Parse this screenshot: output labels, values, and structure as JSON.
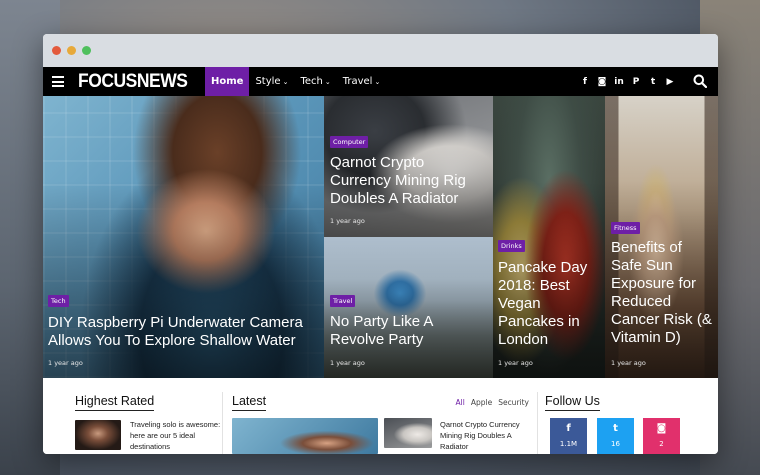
{
  "nav": {
    "logo": "FOCUSNEWS",
    "menu": [
      {
        "label": "Home",
        "active": true
      },
      {
        "label": "Style",
        "caret": "⌄"
      },
      {
        "label": "Tech",
        "caret": "⌄"
      },
      {
        "label": "Travel",
        "caret": "⌄"
      }
    ],
    "socials": [
      "f",
      "◙",
      "in",
      "P",
      "t",
      "▶"
    ],
    "accent_color": "#6e1fa6"
  },
  "hero": [
    {
      "category": "Tech",
      "title": "DIY Raspberry Pi Underwater Camera Allows You To Explore Shallow Water",
      "date": "1 year ago"
    },
    {
      "category": "Computer",
      "title": "Qarnot Crypto Currency Mining Rig Doubles A Radiator",
      "date": "1 year ago"
    },
    {
      "category": "Travel",
      "title": "No Party Like A Revolve Party",
      "date": "1 year ago"
    },
    {
      "category": "Drinks",
      "title": "Pancake Day 2018: Best Vegan Pancakes in London",
      "date": "1 year ago"
    },
    {
      "category": "Fitness",
      "title": "Benefits of Safe Sun Exposure for Reduced Cancer Risk (& Vitamin D)",
      "date": "1 year ago"
    }
  ],
  "highest_rated": {
    "title": "Highest Rated",
    "item_text": "Traveling solo is awesome: here are our 5 ideal destinations"
  },
  "latest": {
    "title": "Latest",
    "filters": [
      "All",
      "Apple",
      "Security"
    ],
    "item_text": "Qarnot Crypto Currency Mining Rig Doubles A Radiator"
  },
  "follow": {
    "title": "Follow Us",
    "boxes": [
      {
        "icon": "f",
        "count": "1.1M",
        "color": "#3b5998"
      },
      {
        "icon": "t",
        "count": "16",
        "color": "#1da1f2"
      },
      {
        "icon": "◙",
        "count": "2",
        "color": "#e1306c"
      }
    ]
  }
}
